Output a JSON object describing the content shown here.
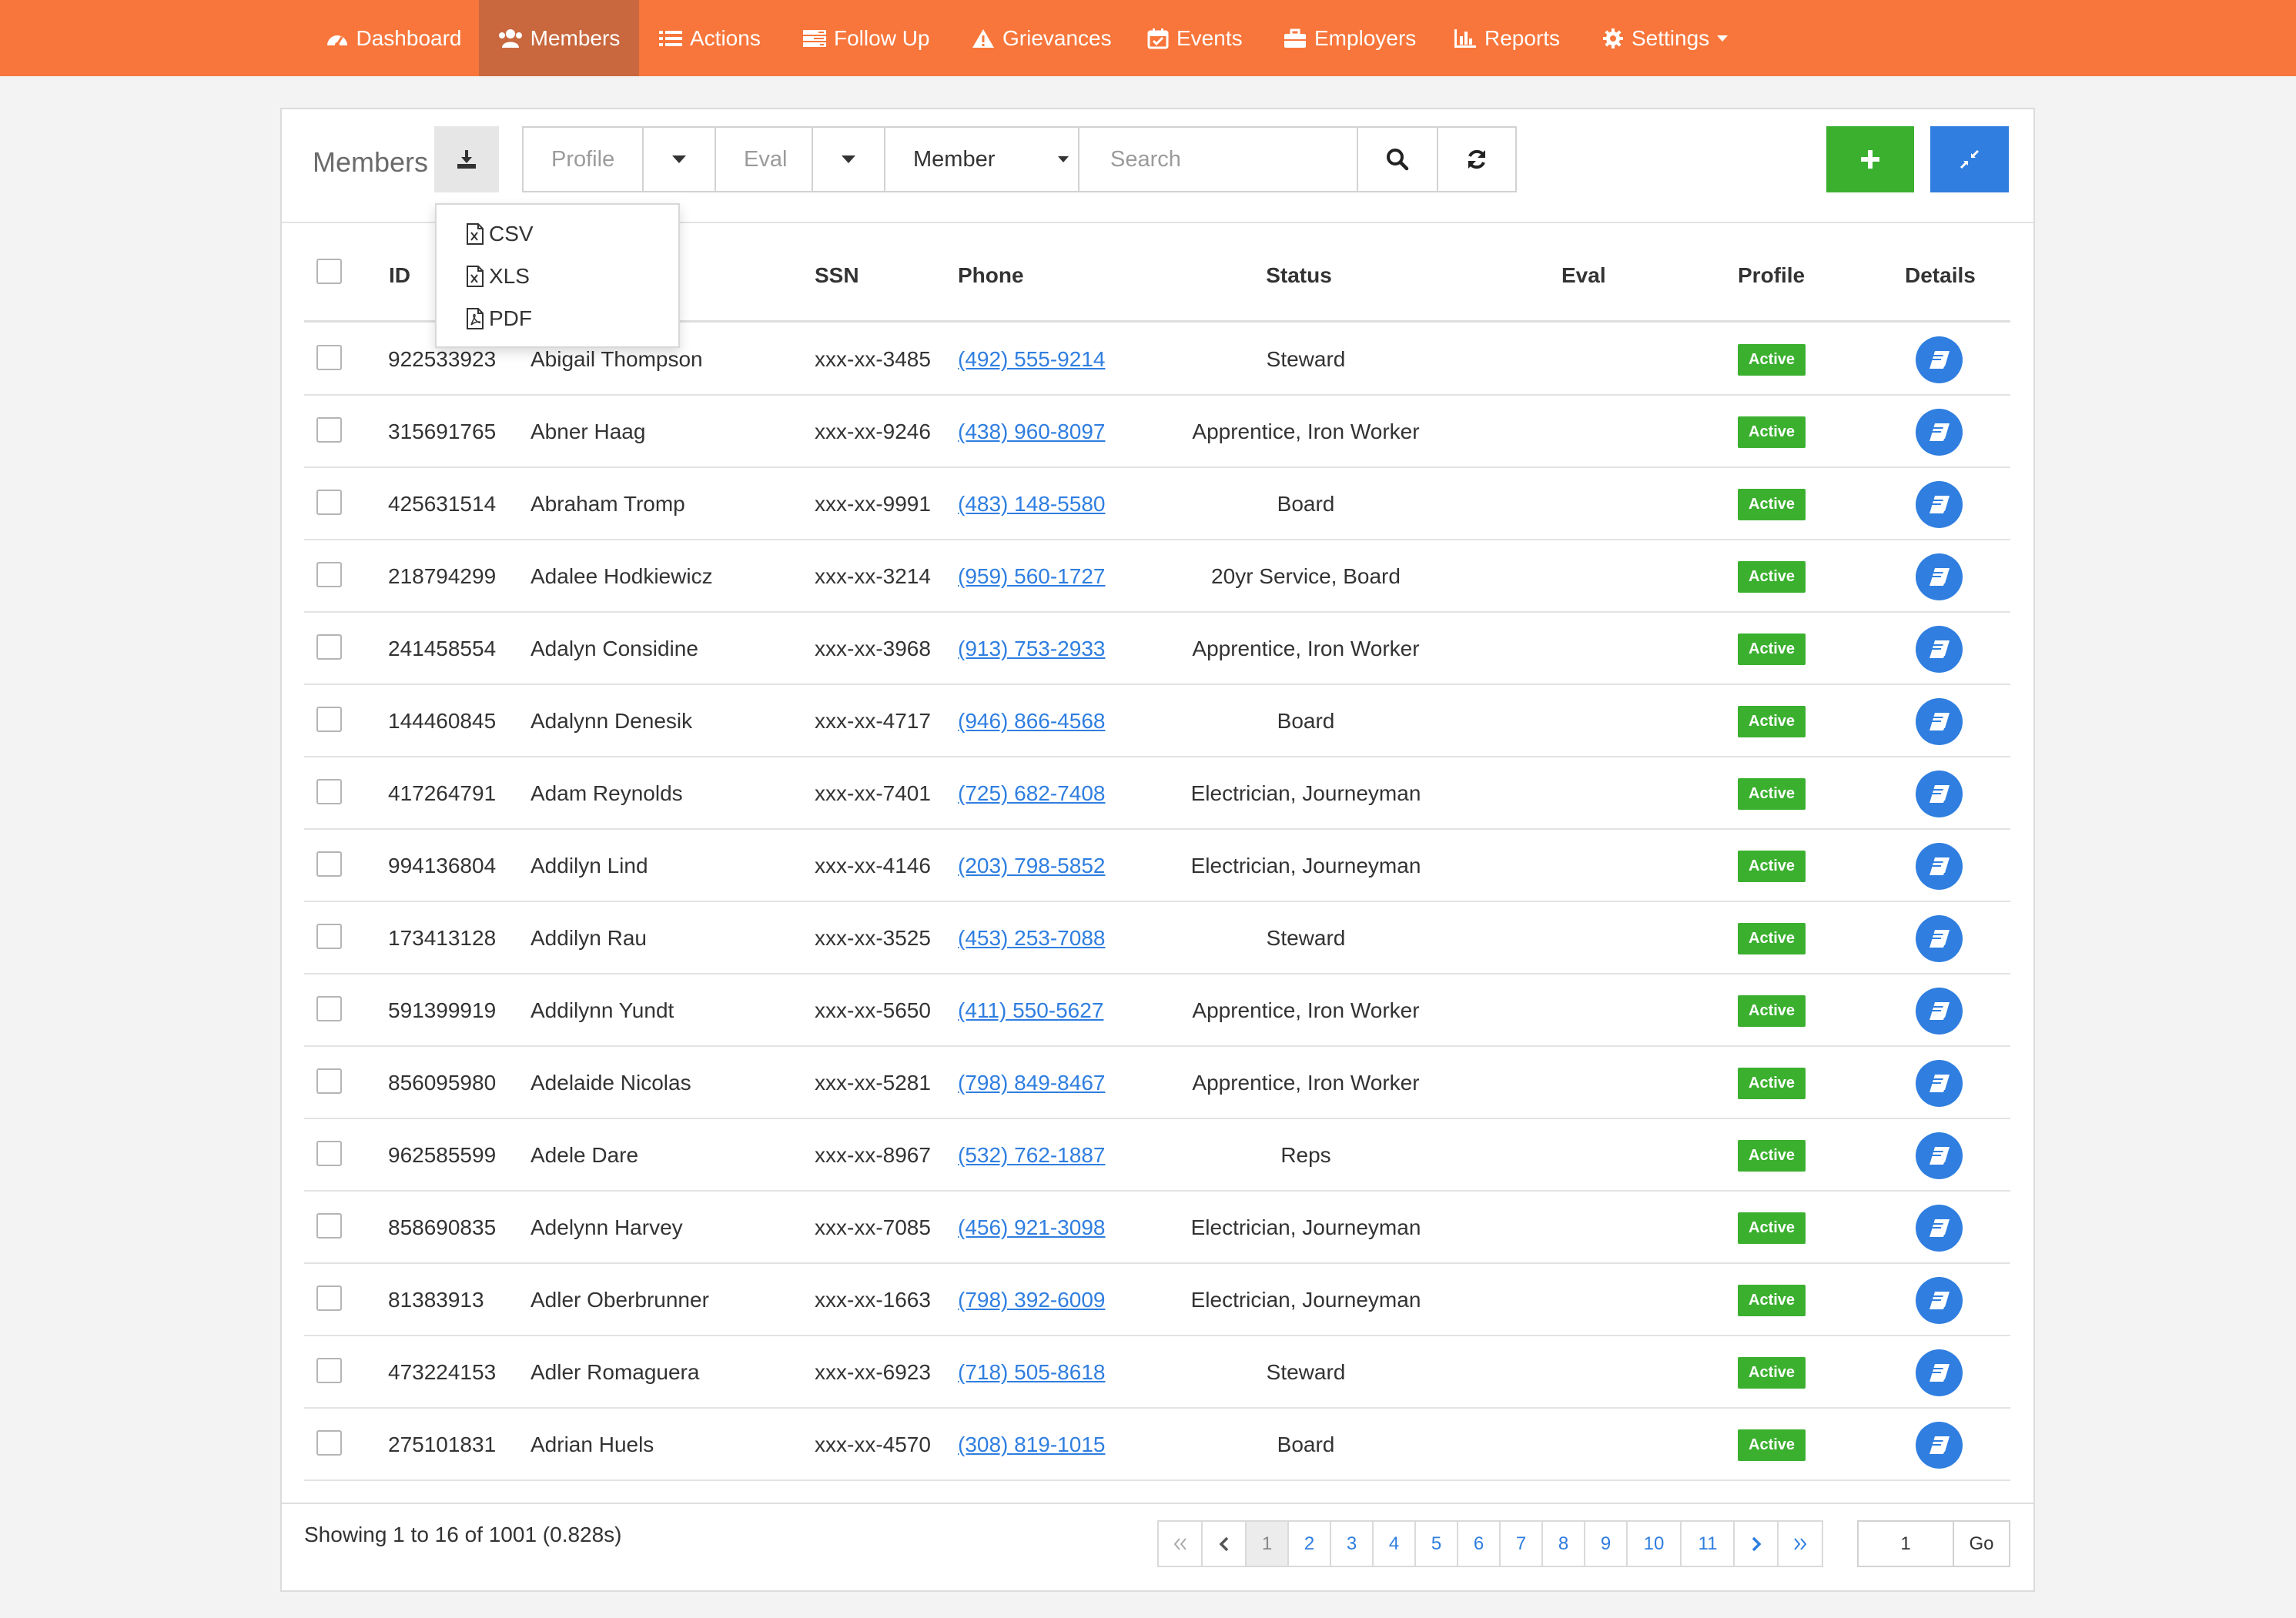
{
  "nav": {
    "items": [
      {
        "label": "Dashboard",
        "icon": "dashboard-icon"
      },
      {
        "label": "Members",
        "icon": "users-icon",
        "active": true
      },
      {
        "label": "Actions",
        "icon": "list-icon"
      },
      {
        "label": "Follow Up",
        "icon": "tasks-icon"
      },
      {
        "label": "Grievances",
        "icon": "warning-icon"
      },
      {
        "label": "Events",
        "icon": "calendar-check-icon"
      },
      {
        "label": "Employers",
        "icon": "briefcase-icon"
      },
      {
        "label": "Reports",
        "icon": "bar-chart-icon"
      },
      {
        "label": "Settings",
        "icon": "gear-icon"
      }
    ],
    "color": "#f8763b",
    "active_color": "#c9683e"
  },
  "toolbar": {
    "title": "Members",
    "profile_placeholder": "Profile",
    "eval_placeholder": "Eval",
    "member_select": "Member",
    "search_placeholder": "Search"
  },
  "export_menu": {
    "items": [
      "CSV",
      "XLS",
      "PDF"
    ]
  },
  "table": {
    "headers": {
      "id": "ID",
      "ssn": "SSN",
      "phone": "Phone",
      "status": "Status",
      "eval": "Eval",
      "profile": "Profile",
      "details": "Details"
    },
    "rows": [
      {
        "id": "922533923",
        "name": "Abigail Thompson",
        "ssn": "xxx-xx-3485",
        "phone": "(492) 555-9214",
        "status": "Steward",
        "eval": "",
        "profile": "Active"
      },
      {
        "id": "315691765",
        "name": "Abner Haag",
        "ssn": "xxx-xx-9246",
        "phone": "(438) 960-8097",
        "status": "Apprentice, Iron Worker",
        "eval": "",
        "profile": "Active"
      },
      {
        "id": "425631514",
        "name": "Abraham Tromp",
        "ssn": "xxx-xx-9991",
        "phone": "(483) 148-5580",
        "status": "Board",
        "eval": "",
        "profile": "Active"
      },
      {
        "id": "218794299",
        "name": "Adalee Hodkiewicz",
        "ssn": "xxx-xx-3214",
        "phone": "(959) 560-1727",
        "status": "20yr Service, Board",
        "eval": "",
        "profile": "Active"
      },
      {
        "id": "241458554",
        "name": "Adalyn Considine",
        "ssn": "xxx-xx-3968",
        "phone": "(913) 753-2933",
        "status": "Apprentice, Iron Worker",
        "eval": "",
        "profile": "Active"
      },
      {
        "id": "144460845",
        "name": "Adalynn Denesik",
        "ssn": "xxx-xx-4717",
        "phone": "(946) 866-4568",
        "status": "Board",
        "eval": "",
        "profile": "Active"
      },
      {
        "id": "417264791",
        "name": "Adam Reynolds",
        "ssn": "xxx-xx-7401",
        "phone": "(725) 682-7408",
        "status": "Electrician, Journeyman",
        "eval": "",
        "profile": "Active"
      },
      {
        "id": "994136804",
        "name": "Addilyn Lind",
        "ssn": "xxx-xx-4146",
        "phone": "(203) 798-5852",
        "status": "Electrician, Journeyman",
        "eval": "",
        "profile": "Active"
      },
      {
        "id": "173413128",
        "name": "Addilyn Rau",
        "ssn": "xxx-xx-3525",
        "phone": "(453) 253-7088",
        "status": "Steward",
        "eval": "",
        "profile": "Active"
      },
      {
        "id": "591399919",
        "name": "Addilynn Yundt",
        "ssn": "xxx-xx-5650",
        "phone": "(411) 550-5627",
        "status": "Apprentice, Iron Worker",
        "eval": "",
        "profile": "Active"
      },
      {
        "id": "856095980",
        "name": "Adelaide Nicolas",
        "ssn": "xxx-xx-5281",
        "phone": "(798) 849-8467",
        "status": "Apprentice, Iron Worker",
        "eval": "",
        "profile": "Active"
      },
      {
        "id": "962585599",
        "name": "Adele Dare",
        "ssn": "xxx-xx-8967",
        "phone": "(532) 762-1887",
        "status": "Reps",
        "eval": "",
        "profile": "Active"
      },
      {
        "id": "858690835",
        "name": "Adelynn Harvey",
        "ssn": "xxx-xx-7085",
        "phone": "(456) 921-3098",
        "status": "Electrician, Journeyman",
        "eval": "",
        "profile": "Active"
      },
      {
        "id": "81383913",
        "name": "Adler Oberbrunner",
        "ssn": "xxx-xx-1663",
        "phone": "(798) 392-6009",
        "status": "Electrician, Journeyman",
        "eval": "",
        "profile": "Active"
      },
      {
        "id": "473224153",
        "name": "Adler Romaguera",
        "ssn": "xxx-xx-6923",
        "phone": "(718) 505-8618",
        "status": "Steward",
        "eval": "",
        "profile": "Active"
      },
      {
        "id": "275101831",
        "name": "Adrian Huels",
        "ssn": "xxx-xx-4570",
        "phone": "(308) 819-1015",
        "status": "Board",
        "eval": "",
        "profile": "Active"
      }
    ]
  },
  "footer": {
    "showing": "Showing 1 to 16 of 1001 (0.828s)",
    "pages": [
      "1",
      "2",
      "3",
      "4",
      "5",
      "6",
      "7",
      "8",
      "9",
      "10",
      "11"
    ],
    "current_page": "1",
    "goto_value": "1",
    "go_label": "Go"
  },
  "colors": {
    "add_button": "#3bb02f",
    "collapse_button": "#2f7ee0",
    "badge_active": "#3bb02f",
    "link": "#2f7ee0"
  }
}
